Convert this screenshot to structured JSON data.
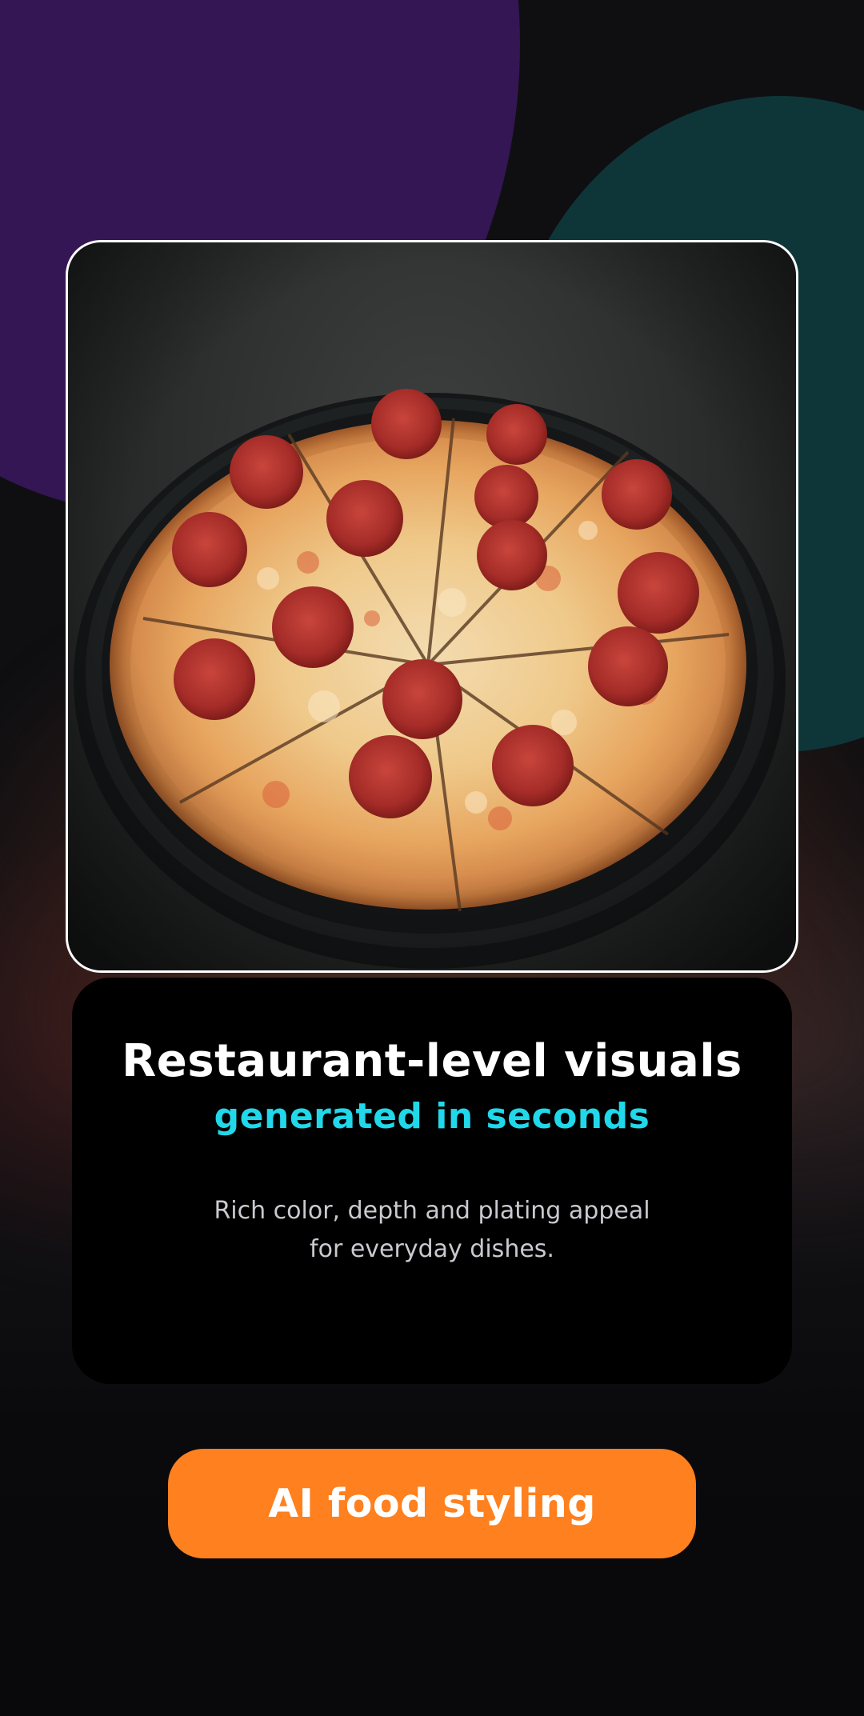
{
  "hero": {
    "image_subject": "pepperoni pizza on dark pan",
    "headline": "Restaurant-level visuals",
    "subheadline": "generated in seconds",
    "description_line1": "Rich color, depth and plating appeal",
    "description_line2": "for everyday dishes."
  },
  "cta": {
    "label": "AI food styling"
  },
  "colors": {
    "background": "#0f0f12",
    "purple_blob": "#331653",
    "teal_blob": "#0e3639",
    "card_background": "#000000",
    "headline": "#ffffff",
    "accent_cyan": "#20d8ea",
    "description": "#c9c9d0",
    "cta_orange": "#ff801e"
  }
}
